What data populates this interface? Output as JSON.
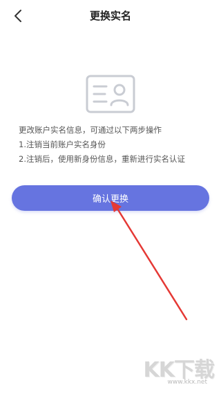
{
  "header": {
    "title": "更换实名",
    "back_icon": "chevron-left-icon"
  },
  "illustration": {
    "icon": "id-card-icon",
    "color": "#c9ccd3"
  },
  "info": {
    "lines": [
      "更改账户实名信息，可通过以下两步操作",
      "1.注销当前账户实名身份",
      "2.注销后，使用新身份信息，重新进行实名认证"
    ]
  },
  "actions": {
    "confirm_label": "确认更换",
    "confirm_color": "#6674e0"
  },
  "annotation": {
    "arrow_color": "#e53935"
  },
  "watermark": {
    "logo": "KK下载",
    "url": "www.kkx.net"
  }
}
